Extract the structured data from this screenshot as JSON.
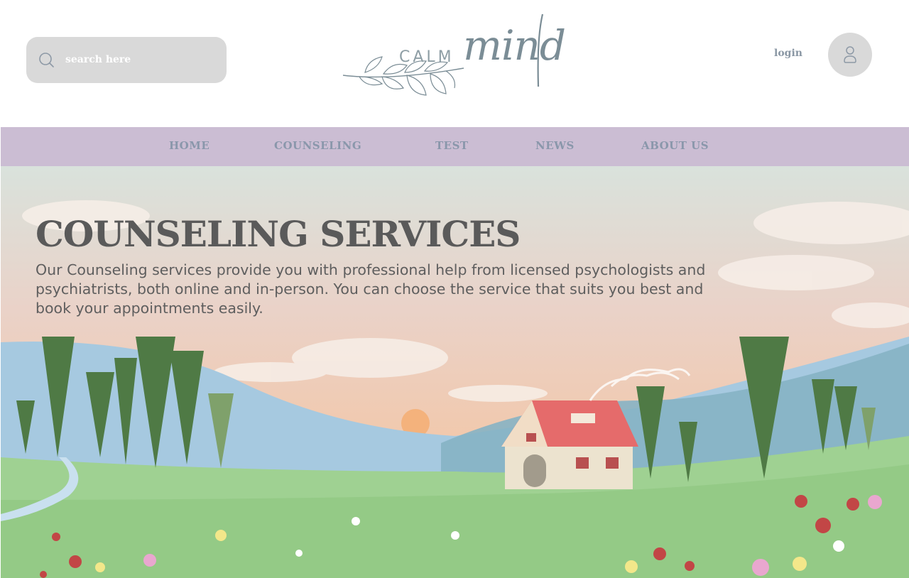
{
  "header": {
    "search": {
      "placeholder": "search here"
    },
    "logo": {
      "calm": "CALM",
      "mind": "mind"
    },
    "login_label": "login"
  },
  "nav": {
    "items": [
      {
        "label": "HOME"
      },
      {
        "label": "COUNSELING"
      },
      {
        "label": "TEST"
      },
      {
        "label": "NEWS"
      },
      {
        "label": "ABOUT US"
      }
    ]
  },
  "hero": {
    "title": "COUNSELING SERVICES",
    "description": "Our Counseling services provide you with professional help from licensed psychologists and psychiatrists, both online and in-person. You can choose the service that suits you best and book your appointments easily."
  },
  "colors": {
    "nav_bg": "#cbbdd3",
    "nav_text": "#8a97ab",
    "search_bg": "#d9d9d9",
    "title_text": "#5a5a5a"
  },
  "icons": {
    "search": "search-icon",
    "user": "user-icon",
    "logo_branch": "leaf-branch-icon"
  }
}
